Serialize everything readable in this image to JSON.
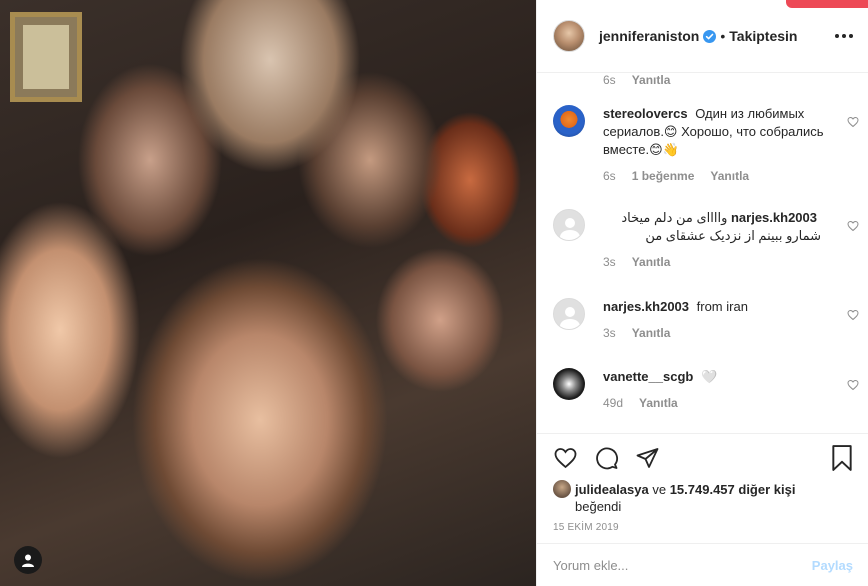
{
  "post": {
    "author": "jenniferaniston",
    "follow_status": "Takiptesin",
    "separator": "•"
  },
  "comments": [
    {
      "username": "",
      "text": "",
      "time": "6s",
      "reply_label": "Yanıtla",
      "partial": true
    },
    {
      "username": "stereolovercs",
      "text": "Один из любимых сериалов.😊 Хорошо, что собрались вместе.😊👋",
      "time": "6s",
      "likes": "1 beğenme",
      "reply_label": "Yanıtla",
      "avatar": "stereo-avatar"
    },
    {
      "username": "narjes.kh2003",
      "text": "واااای من دلم میخاد شمارو ببینم از نزدیک عشقای من",
      "time": "3s",
      "reply_label": "Yanıtla",
      "avatar": "default-avatar"
    },
    {
      "username": "narjes.kh2003",
      "text": "from iran",
      "time": "3s",
      "reply_label": "Yanıtla",
      "avatar": "default-avatar"
    },
    {
      "username": "vanette__scgb",
      "text": "🤍",
      "time": "49d",
      "reply_label": "Yanıtla",
      "avatar": "vanette-avatar"
    }
  ],
  "likes": {
    "first_liker": "julidealasya",
    "connector": "ve",
    "others_count": "15.749.457 diğer kişi",
    "suffix": "beğendi"
  },
  "date": "15 EKİM 2019",
  "add_comment": {
    "placeholder": "Yorum ekle...",
    "post_label": "Paylaş"
  },
  "colors": {
    "accent": "#ed4956",
    "verified": "#3897f0",
    "post_disabled": "#b3dbff",
    "meta_gray": "#8e8e8e"
  },
  "icons": [
    "user-tag-icon",
    "verified-badge-icon",
    "more-options-icon",
    "heart-icon",
    "comment-icon",
    "share-icon",
    "bookmark-icon"
  ]
}
